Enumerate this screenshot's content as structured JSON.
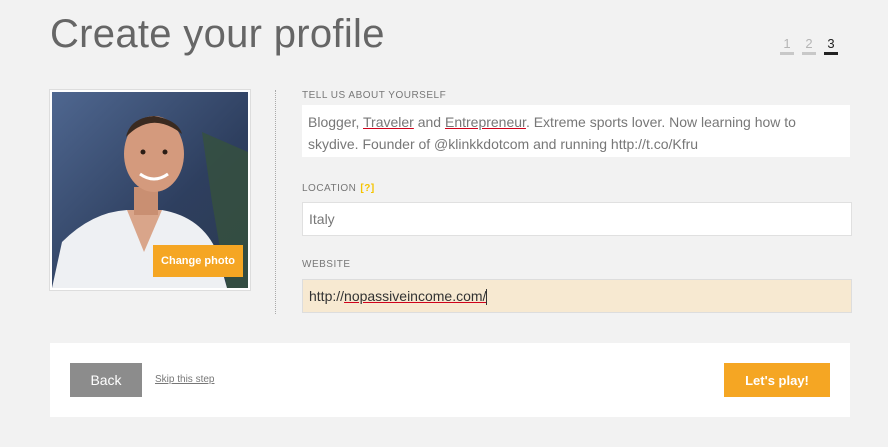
{
  "page": {
    "title": "Create your profile"
  },
  "steps": [
    {
      "label": "1",
      "active": false
    },
    {
      "label": "2",
      "active": false
    },
    {
      "label": "3",
      "active": true
    }
  ],
  "photo": {
    "change_label": "Change photo"
  },
  "about": {
    "label": "TELL US ABOUT YOURSELF",
    "value_parts": [
      {
        "text": "Blogger, ",
        "underline": false
      },
      {
        "text": "Traveler",
        "underline": true
      },
      {
        "text": " and ",
        "underline": false
      },
      {
        "text": "Entrepreneur",
        "underline": true
      },
      {
        "text": ". Extreme sports lover. Now learning how to skydive. Founder of @klinkkdotcom and running http://t.co/Kfru",
        "underline": false
      }
    ]
  },
  "location": {
    "label": "LOCATION",
    "help": "[?]",
    "value": "Italy"
  },
  "website": {
    "label": "WEBSITE",
    "value_prefix": "http://",
    "value_underlined": "nopassiveincome.com/"
  },
  "footer": {
    "back_label": "Back",
    "skip_label": "Skip this step",
    "play_label": "Let's play!"
  },
  "colors": {
    "accent": "#f5a623",
    "background": "#f2f2f2",
    "focused_input": "#f7e9d1",
    "back_button": "#8c8c8c"
  }
}
